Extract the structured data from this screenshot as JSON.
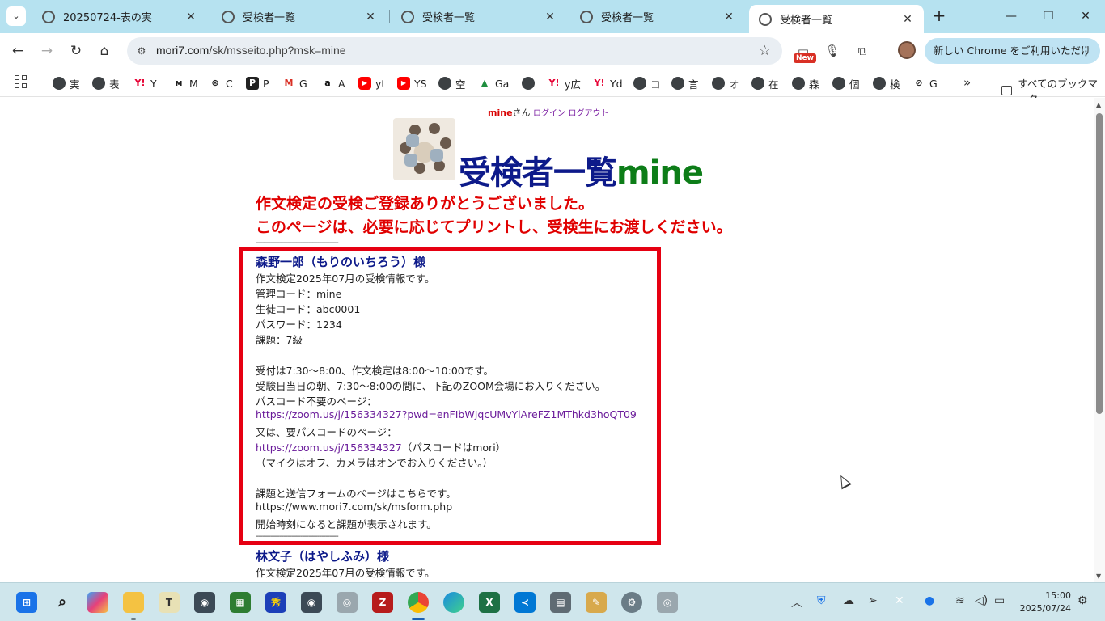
{
  "browser": {
    "tabs": [
      {
        "title": "20250724-表の実",
        "active": false
      },
      {
        "title": "受検者一覧",
        "active": false
      },
      {
        "title": "受検者一覧",
        "active": false
      },
      {
        "title": "受検者一覧",
        "active": false
      },
      {
        "title": "受検者一覧",
        "active": true
      }
    ],
    "url_domain": "mori7.com",
    "url_path": "/sk/msseito.php?msk=mine",
    "new_badge": "New",
    "update_button": "新しい Chrome をご利用いただけます",
    "bookmarks": [
      {
        "label": "実",
        "icon": "globe-icon"
      },
      {
        "label": "表",
        "icon": "globe-icon"
      },
      {
        "label": "Y",
        "icon": "yahoo-icon"
      },
      {
        "label": "M",
        "icon": "m-icon"
      },
      {
        "label": "C",
        "icon": "openai-icon"
      },
      {
        "label": "P",
        "icon": "p-icon"
      },
      {
        "label": "G",
        "icon": "gmail-icon"
      },
      {
        "label": "A",
        "icon": "amazon-icon"
      },
      {
        "label": "yt",
        "icon": "youtube-icon"
      },
      {
        "label": "YS",
        "icon": "youtube-icon"
      },
      {
        "label": "空",
        "icon": "globe-icon"
      },
      {
        "label": "Ga",
        "icon": "google-drive-icon"
      },
      {
        "label": "",
        "icon": "globe-icon"
      },
      {
        "label": "y広",
        "icon": "yahoo-icon"
      },
      {
        "label": "Yd",
        "icon": "yahoo-icon"
      },
      {
        "label": "コ",
        "icon": "globe-icon"
      },
      {
        "label": "言",
        "icon": "globe-icon"
      },
      {
        "label": "オ",
        "icon": "globe-icon"
      },
      {
        "label": "在",
        "icon": "globe-icon"
      },
      {
        "label": "森",
        "icon": "globe-icon"
      },
      {
        "label": "個",
        "icon": "globe-icon"
      },
      {
        "label": "検",
        "icon": "globe-icon"
      },
      {
        "label": "G",
        "icon": "slash-icon"
      }
    ],
    "bookmarks_all": "すべてのブックマーク"
  },
  "page": {
    "user_name": "mine",
    "user_suffix": "さん",
    "login": "ログイン",
    "logout": "ログアウト",
    "title_main": "受検者一覧",
    "title_sub": "mine",
    "notice_1": "作文検定の受検ご登録ありがとうございました。",
    "notice_2": "このページは、必要に応じてプリントし、受検生にお渡しください。",
    "divider": "---------------------------------------",
    "students": [
      {
        "name": "森野一郎（もりのいちろう）様",
        "info": "作文検定2025年07月の受検情報です。",
        "admin_code": "管理コード：mine",
        "student_code": "生徒コード：abc0001",
        "password": "パスワード：1234",
        "task": "課題：7級",
        "reception": "受付は7:30～8:00、作文検定は8:00～10:00です。",
        "enter_zoom": "受験日当日の朝、7:30～8:00の間に、下記のZOOM会場にお入りください。",
        "no_passcode_label": "パスコード不要のページ：",
        "zoom_url_1": "https://zoom.us/j/156334327?pwd=enFIbWJqcUMvYlAreFZ1MThkd3hoQT09",
        "passcode_label": "又は、要パスコードのページ：",
        "zoom_url_2": "https://zoom.us/j/156334327",
        "passcode_note": "（パスコードはmori）",
        "mic_note": "（マイクはオフ、カメラはオンでお入りください。）",
        "form_label": "課題と送信フォームのページはこちらです。",
        "form_url": "https://www.mori7.com/sk/msform.php",
        "start_note": "開始時刻になると課題が表示されます。"
      },
      {
        "name": "林文子（はやしふみ）様",
        "info": "作文検定2025年07月の受検情報です。"
      }
    ]
  },
  "taskbar": {
    "time": "15:00",
    "date": "2025/07/24"
  },
  "colors": {
    "tab_strip": "#b6e2f0",
    "highlight_border": "#e60012",
    "title_blue": "#0d1a8a",
    "title_green": "#0d7d18",
    "notice_red": "#e00000"
  }
}
